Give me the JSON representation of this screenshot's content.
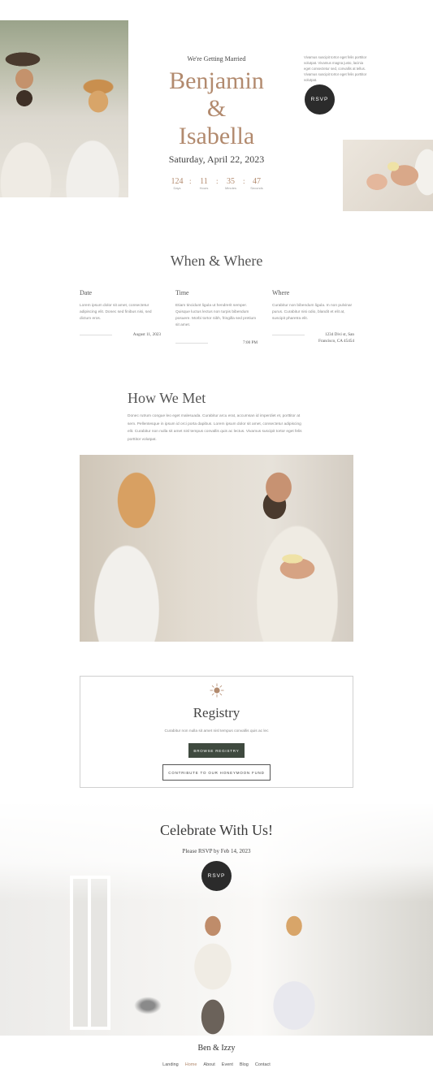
{
  "hero": {
    "eyebrow": "We're Getting Married",
    "name_1": "Benjamin",
    "ampersand": "&",
    "name_2": "Isabella",
    "date": "Saturday, April 22, 2023",
    "countdown": [
      {
        "value": "124",
        "label": "Days"
      },
      {
        "value": "11",
        "label": "Hours"
      },
      {
        "value": "35",
        "label": "Minutes"
      },
      {
        "value": "47",
        "label": "Seconds"
      }
    ],
    "note": "Vivamus suscipit tortor eget felis porttitor volutpat. Vivamus magna justo, lacinia eget consectetur sed, convallis at tellus. Vivamus suscipit tortor eget felis porttitor volutpat.",
    "rsvp_label": "RSVP"
  },
  "when_where": {
    "title": "When & Where",
    "columns": [
      {
        "label": "Date",
        "text": "Lorem ipsum dolor sit amet, consectetur adipiscing elit. Donec sed finibus nisi, sed dictum eros.",
        "value": "August 11, 2023"
      },
      {
        "label": "Time",
        "text": "Etiam tincidunt ligula ut hendrerit semper. Quisque luctus lectus non turpis bibendum posuere. Morbi tortor nibh, fringilla sed pretium sit amet.",
        "value": "7:00 PM"
      },
      {
        "label": "Where",
        "text": "Curabitur non bibendum ligula. In non pulvinar purus. Curabitur nisi odio, blandit et elit at, suscipit pharetra elit.",
        "value": "1234 Divi st, San Francisco, CA 45454"
      }
    ]
  },
  "how_we_met": {
    "title": "How We Met",
    "text": "Donec rutrum congue leo eget malesuada. Curabitur arcu erat, accumsan id imperdiet et, porttitor at sem. Pellentesque in ipsum id orci porta dapibus. Lorem ipsum dolor sit amet, consectetur adipiscing elit. Curabitur non nulla sit amet nisl tempus convallis quis ac lectus. Vivamus suscipit tortor eget felis porttitor volutpat."
  },
  "registry": {
    "title": "Registry",
    "text": "Curabitur non nulla sit amet nisl tempus convallis quis ac lec",
    "browse_label": "BROWSE REGISTRY",
    "honeymoon_label": "CONTRIBUTE TO OUR HONEYMOON FUND"
  },
  "celebrate": {
    "title": "Celebrate With Us!",
    "subtitle": "Please RSVP by Feb 14, 2023",
    "rsvp_label": "RSVP"
  },
  "footer": {
    "brand": "Ben & Izzy",
    "nav": [
      "Landing",
      "Home",
      "About",
      "Event",
      "Blog",
      "Contact"
    ],
    "active": "Home"
  },
  "colors": {
    "accent": "#b28a6e",
    "dark_button": "#3f4a3f",
    "rsvp_circle": "#2b2b2b"
  }
}
